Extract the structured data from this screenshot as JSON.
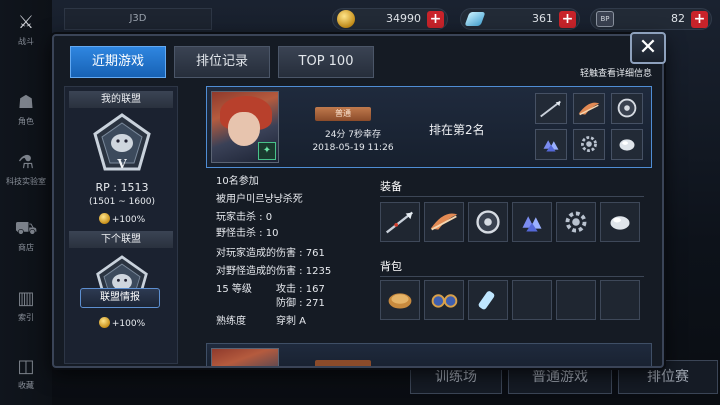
{
  "side_menu": {
    "items": [
      {
        "label": "战斗",
        "icon": "crossed-swords-icon"
      },
      {
        "label": "角色",
        "icon": "character-icon"
      },
      {
        "label": "科技实验室",
        "icon": "flask-icon"
      },
      {
        "label": "商店",
        "icon": "cart-icon"
      },
      {
        "label": "索引",
        "icon": "books-icon"
      },
      {
        "label": "收藏",
        "icon": "open-book-icon"
      }
    ]
  },
  "topbar": {
    "player_name": "J3D",
    "gold": "34990",
    "gems": "361",
    "tickets": "82",
    "ticket_icon_text": "BP"
  },
  "background_buttons": [
    "训练场",
    "普通游戏",
    "排位赛"
  ],
  "dialog": {
    "tabs": [
      "近期游戏",
      "排位记录",
      "TOP 100"
    ],
    "hint": "轻触查看详细信息",
    "close_label": "✕"
  },
  "alliance": {
    "my_title": "我的联盟",
    "my_tier": "V",
    "rp": "RP : 1513",
    "rp_range": "(1501 ~ 1600)",
    "my_bonus": "+100%",
    "next_title": "下个联盟",
    "next_tier": "IV",
    "next_bonus": "+100%",
    "info_button": "联盟情报"
  },
  "match": {
    "mode": "普通",
    "survival": "24分 7秒幸存",
    "datetime": "2018-05-19 11:26",
    "rank": "排在第2名",
    "participants": "10名参加",
    "killed_by": "被用户미르냥냥杀死",
    "player_kills": "玩家击杀 : 0",
    "monster_kills": "野怪击杀 : 10",
    "player_damage": "对玩家造成的伤害 : 761",
    "monster_damage": "对野怪造成的伤害 : 1235",
    "level": "15 等级",
    "attack": "攻击 : 167",
    "defense": "防御 : 271",
    "proficiency_label": "熟练度",
    "proficiency_value": "穿刺 A",
    "equipment_title": "装备",
    "bag_title": "背包",
    "mini_items": [
      "spear-icon",
      "wing-blade-icon",
      "disc-icon",
      "gem-cluster-icon",
      "gear-icon",
      "orb-icon"
    ],
    "equipment": [
      "spear-icon",
      "wing-blade-icon",
      "disc-icon",
      "gem-cluster-icon",
      "gear-icon",
      "orb-icon"
    ],
    "bag": [
      "bread-icon",
      "goggles-icon",
      "potion-icon",
      "",
      "",
      ""
    ]
  }
}
